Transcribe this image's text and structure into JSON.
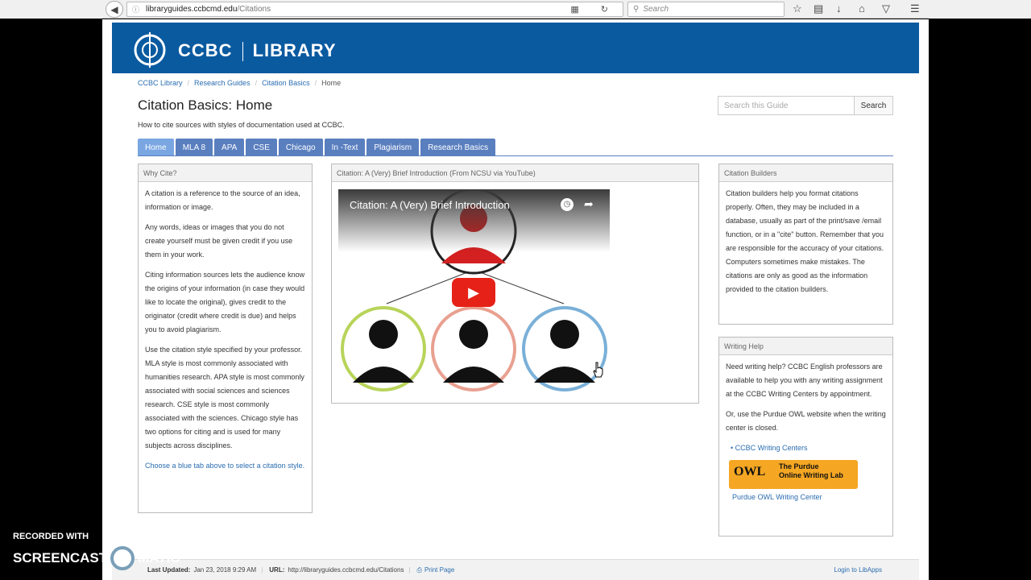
{
  "browser": {
    "url_host": "libraryguides.ccbcmd.edu",
    "url_path": "/Citations",
    "search_placeholder": "Search"
  },
  "banner": {
    "brand_left": "CCBC",
    "brand_right": "LIBRARY",
    "color": "#0a5aa0"
  },
  "breadcrumb": [
    "CCBC Library",
    "Research Guides",
    "Citation Basics",
    "Home"
  ],
  "page": {
    "title": "Citation Basics: Home",
    "subtitle": "How to cite sources with styles of documentation used at CCBC.",
    "guide_search_placeholder": "Search this Guide",
    "guide_search_button": "Search"
  },
  "tabs": [
    "Home",
    "MLA 8",
    "APA",
    "CSE",
    "Chicago",
    "In -Text",
    "Plagiarism",
    "Research Basics"
  ],
  "why_cite": {
    "heading": "Why Cite?",
    "p1": "A citation is a reference to the source of an idea, information or image.",
    "p2": "Any words, ideas or images that you do not create yourself must be given credit if you use them in your work.",
    "p3": "Citing information sources lets the audience know the origins of your information (in case they would like to locate the original), gives credit to the originator (credit where credit is due) and helps you to avoid plagiarism.",
    "p4": "Use the citation style specified by your professor. MLA style is most commonly associated with humanities research. APA style is most commonly associated with social sciences and sciences research. CSE style is most commonly associated with the sciences. Chicago style has two options for citing and is used for many subjects across disciplines.",
    "p5": "Choose a blue tab above to select a citation style."
  },
  "video": {
    "heading": "Citation: A (Very) Brief Introduction (From NCSU via YouTube)",
    "title": "Citation: A (Very) Brief Introduction"
  },
  "builders": {
    "heading": "Citation Builders",
    "text": "Citation builders help you format citations properly. Often, they may be included in a database, usually as part of the print/save /email function, or in a \"cite\" button. Remember that you are responsible for the accuracy of your citations. Computers sometimes make mistakes. The citations are only as good as the information provided to the citation builders."
  },
  "writing": {
    "heading": "Writing Help",
    "p1": "Need writing help? CCBC English professors are available to help you with any writing assignment at the CCBC Writing Centers by appointment.",
    "p2": "Or, use the Purdue OWL website when the writing center is closed.",
    "link1": "CCBC Writing Centers",
    "owl_word": "OWL",
    "owl_sub_1": "The Purdue",
    "owl_sub_2": "Online Writing Lab",
    "link2": "Purdue OWL Writing Center"
  },
  "footer": {
    "updated_label": "Last Updated:",
    "updated_value": "Jan 23, 2018 9:29 AM",
    "url_label": "URL:",
    "url_value": "http://libraryguides.ccbcmd.edu/Citations",
    "print": "Print Page",
    "login": "Login to LibApps"
  },
  "watermark": {
    "line1": "RECORDED WITH",
    "line2a": "SCREENCAST",
    "line2b": "MATIC"
  }
}
